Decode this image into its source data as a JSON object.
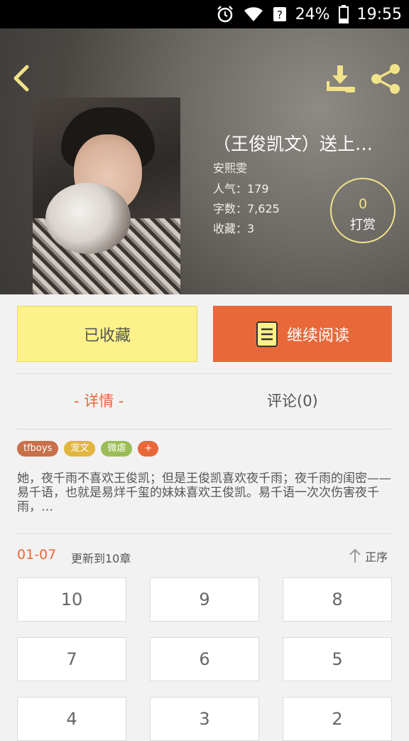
{
  "status_bar": {
    "battery": "24%",
    "time": "19:55"
  },
  "book": {
    "title": "（王俊凯文）送上…",
    "author": "安熙雯",
    "popularity": "人气：179",
    "word_count": "字数：7,625",
    "favorites": "收藏：3"
  },
  "reward": {
    "count": "0",
    "label": "打赏"
  },
  "actions": {
    "favorite_label": "已收藏",
    "read_label": "继续阅读"
  },
  "tabs": {
    "details": "- 详情 -",
    "comments": "评论(0)"
  },
  "tags": [
    {
      "label": "tfboys",
      "color": "#c8704a"
    },
    {
      "label": "宠文",
      "color": "#e2b53e"
    },
    {
      "label": "微虐",
      "color": "#9bbd55"
    },
    {
      "label": "+",
      "color": "#e9683a"
    }
  ],
  "description": "她，夜千雨不喜欢王俊凯；但是王俊凯喜欢夜千雨；夜千雨的闺密——易千语，也就是易烊千玺的妹妹喜欢王俊凯。易千语一次次伤害夜千雨，…",
  "progress": {
    "date": "01-07",
    "update_text": "更新到10章",
    "sort_label": "正序"
  },
  "chapters": [
    "10",
    "9",
    "8",
    "7",
    "6",
    "5",
    "4",
    "3",
    "2"
  ],
  "colors": {
    "accent": "#e9683a",
    "favorite_bg": "#fcf289",
    "icon_yellow": "#f1e38a"
  }
}
